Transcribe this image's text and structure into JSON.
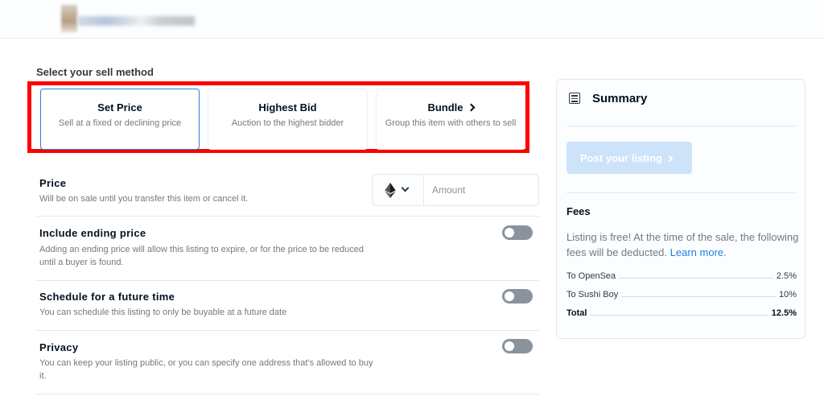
{
  "header": {
    "logo": "blurred-logo"
  },
  "sell_method": {
    "section_title": "Select your sell method",
    "options": [
      {
        "title": "Set Price",
        "description": "Sell at a fixed or declining price",
        "selected": true
      },
      {
        "title": "Highest Bid",
        "description": "Auction to the highest bidder",
        "selected": false
      },
      {
        "title": "Bundle",
        "description": "Group this item with others to sell",
        "selected": false,
        "icon": "chevron-right-icon"
      }
    ],
    "highlight_color": "#ff0000"
  },
  "price": {
    "title": "Price",
    "description": "Will be on sale until you transfer this item or cancel it.",
    "token_icon": "ethereum-icon",
    "amount_placeholder": "Amount"
  },
  "ending_price": {
    "title": "Include ending price",
    "description": "Adding an ending price will allow this listing to expire, or for the price to be reduced until a buyer is found.",
    "enabled": false
  },
  "schedule": {
    "title": "Schedule for a future time",
    "description": "You can schedule this listing to only be buyable at a future date",
    "enabled": false
  },
  "privacy": {
    "title": "Privacy",
    "description": "You can keep your listing public, or you can specify one address that's allowed to buy it.",
    "enabled": false
  },
  "summary": {
    "title": "Summary",
    "icon": "list-icon",
    "post_button_label": "Post your listing",
    "fees_title": "Fees",
    "fees_text": "Listing is free! At the time of the sale, the following fees will be deducted.",
    "learn_more": "Learn more.",
    "fees": [
      {
        "label": "To OpenSea",
        "value": "2.5%"
      },
      {
        "label": "To Sushi Boy",
        "value": "10%"
      }
    ],
    "total": {
      "label": "Total",
      "value": "12.5%"
    }
  },
  "colors": {
    "accent": "#2081e2",
    "button_disabled": "#cde3fa",
    "toggle_off": "#8a939b"
  }
}
